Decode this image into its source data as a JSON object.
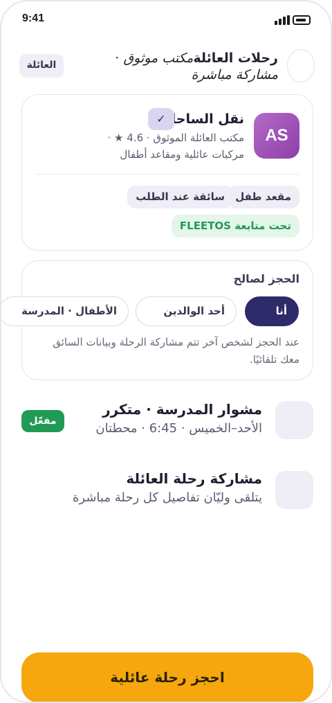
{
  "status_bar": {
    "time": "9:41"
  },
  "header": {
    "title": "رحلات العائلة",
    "subtitle": "مكتب موثوق · مشاركة مباشرة",
    "family_pill": "العائلة"
  },
  "provider": {
    "avatar_initials": "AS",
    "name": "نقل الساحل",
    "verified_mark": "✓",
    "meta_line": "مكتب العائلة الموثوق · 4.6 ★ ·",
    "meta_line2": "مركبات عائلية ومقاعد أطفال",
    "chips": [
      "مقعد طفل",
      "سائقة عند الطلب"
    ],
    "fleet_chip": "تحت متابعة FLEETOS"
  },
  "booking": {
    "title": "الحجز لصالح",
    "options": [
      "أنا",
      "أحد الوالدين",
      "الأطفال · المدرسة"
    ],
    "selected": "أنا",
    "note": "عند الحجز لشخص آخر تتم مشاركة الرحلة وبيانات السائق معك تلقائيًا."
  },
  "features": [
    {
      "title": "مشوار المدرسة · متكرر",
      "subtitle": "الأحد–الخميس · 6:45 · محطتان",
      "badge": "مفعّل"
    },
    {
      "title": "مشاركة رحلة العائلة",
      "subtitle": "يتلقى وليّان تفاصيل كل رحلة مباشرة"
    }
  ],
  "cta": {
    "label": "احجز رحلة عائلية"
  },
  "colors": {
    "accent": "#2f2a6a",
    "cta": "#f5a70d",
    "success": "#1f9b55",
    "avatar": "#a455be"
  }
}
